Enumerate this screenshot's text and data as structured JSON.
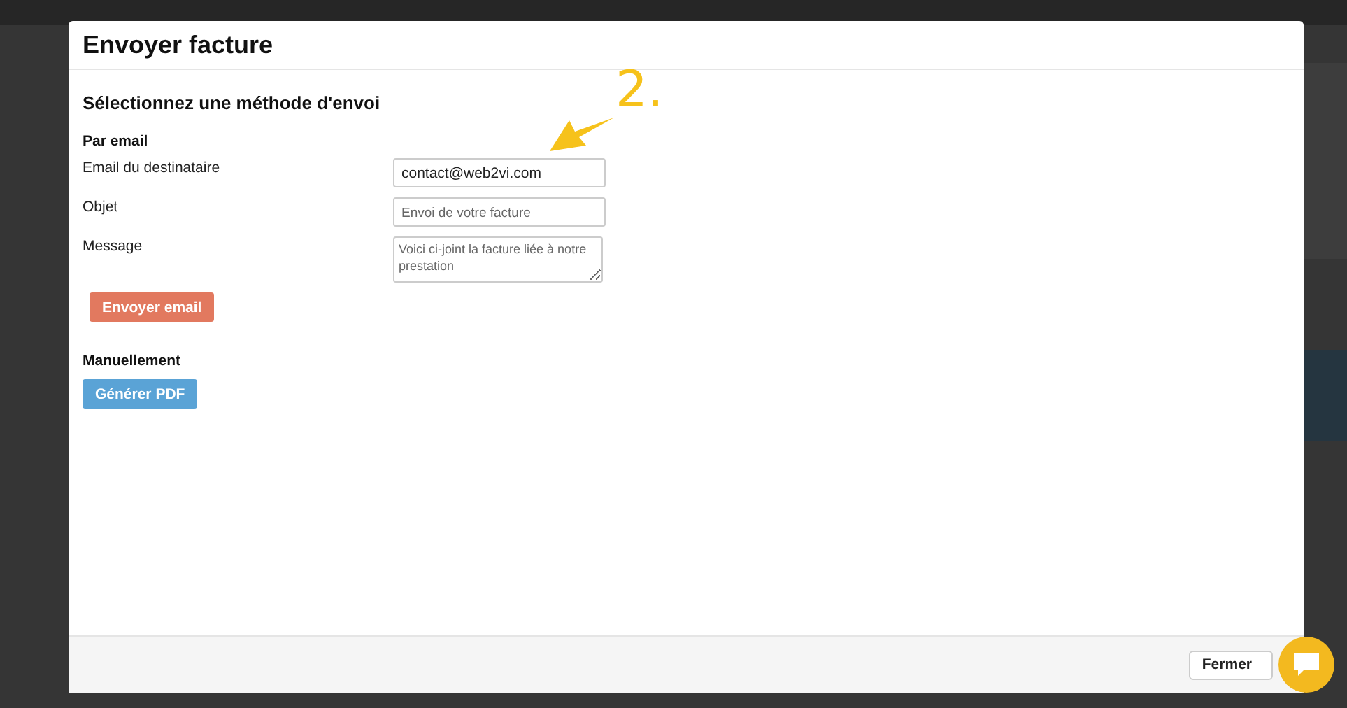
{
  "modal": {
    "title": "Envoyer facture",
    "section_title": "Sélectionnez une méthode d'envoi",
    "email_group": {
      "heading": "Par email",
      "fields": [
        {
          "kind": "input",
          "label": "Email du destinataire",
          "value": "contact@web2vi.com"
        },
        {
          "kind": "input",
          "label": "Objet",
          "placeholder": "Envoi de votre facture"
        },
        {
          "kind": "textarea",
          "label": "Message",
          "placeholder": "Voici ci-joint la facture liée à notre prestation"
        }
      ],
      "button": "Envoyer email"
    },
    "manual_group": {
      "heading": "Manuellement",
      "button": "Générer PDF"
    },
    "footer": {
      "button": "Fermer"
    }
  },
  "annotation": {
    "label": "2."
  }
}
